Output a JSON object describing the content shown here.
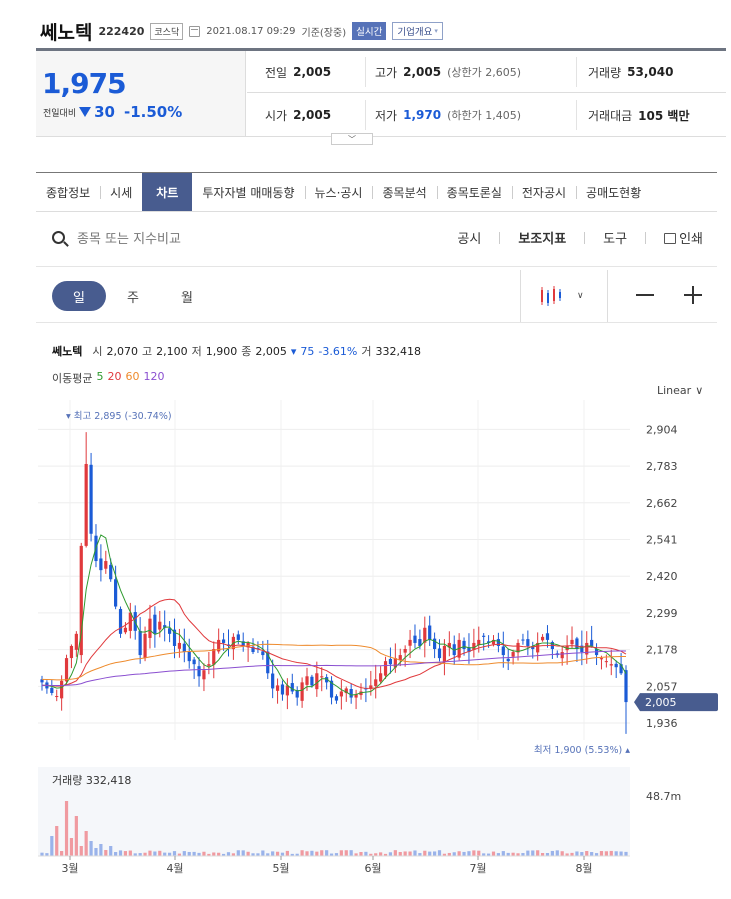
{
  "header": {
    "company": "쎄노텍",
    "code": "222420",
    "market": "코스닥",
    "datetime": "2021.08.17 09:29",
    "basis": "기준(장중)",
    "realtime": "실시간",
    "corp_info": "기업개요"
  },
  "quote": {
    "price": "1,975",
    "change_label": "전일대비",
    "change": "30",
    "change_pct": "-1.50%",
    "prev_close_label": "전일",
    "prev_close": "2,005",
    "high_label": "고가",
    "high": "2,005",
    "upper_limit": "(상한가 2,605)",
    "volume_label": "거래량",
    "volume": "53,040",
    "open_label": "시가",
    "open": "2,005",
    "low_label": "저가",
    "low": "1,970",
    "lower_limit": "(하한가 1,405)",
    "amount_label": "거래대금",
    "amount": "105 백만"
  },
  "tabs": [
    "종합정보",
    "시세",
    "차트",
    "투자자별 매매동향",
    "뉴스·공시",
    "종목분석",
    "종목토론실",
    "전자공시",
    "공매도현황"
  ],
  "active_tab": "차트",
  "search": {
    "placeholder": "종목 또는 지수비교"
  },
  "tools": {
    "disclosure": "공시",
    "indicators": "보조지표",
    "tools": "도구",
    "print": "인쇄"
  },
  "periods": [
    "일",
    "주",
    "월"
  ],
  "active_period": "일",
  "chart_info": {
    "name": "쎄노텍",
    "open_label": "시",
    "open": "2,070",
    "high_label": "고",
    "high": "2,100",
    "low_label": "저",
    "low": "1,900",
    "close_label": "종",
    "close": "2,005",
    "change": "75",
    "change_pct": "-3.61%",
    "vol_label": "거",
    "vol": "332,418"
  },
  "ma_legend": {
    "label": "이동평균",
    "ma5": "5",
    "ma20": "20",
    "ma60": "60",
    "ma120": "120"
  },
  "scale_mode": "Linear",
  "volume_label": "거래량 332,418",
  "colors": {
    "up": "#e0393c",
    "down": "#1b5bd6",
    "accent": "#485c8f"
  },
  "chart_data": {
    "type": "candlestick",
    "y_ticks": [
      "2,904",
      "2,783",
      "2,662",
      "2,541",
      "2,420",
      "2,299",
      "2,178",
      "2,057",
      "1,936"
    ],
    "ylim": [
      1880,
      2935
    ],
    "x_ticks": [
      "3월",
      "4월",
      "5월",
      "6월",
      "7월",
      "8월"
    ],
    "current_price_tag": "2,005",
    "high_marker": "최고 2,895 (-30.74%)",
    "low_marker": "최저 1,900 (5.53%)",
    "volume_axis_tick": "48.7m",
    "close_series": [
      2070,
      2050,
      2035,
      2025,
      2075,
      2150,
      2190,
      2230,
      2520,
      2790,
      2560,
      2470,
      2440,
      2470,
      2410,
      2320,
      2230,
      2250,
      2300,
      2240,
      2160,
      2230,
      2280,
      2230,
      2270,
      2250,
      2230,
      2190,
      2200,
      2170,
      2140,
      2130,
      2090,
      2110,
      2130,
      2180,
      2210,
      2200,
      2190,
      2220,
      2210,
      2190,
      2200,
      2170,
      2180,
      2160,
      2100,
      2050,
      2060,
      2030,
      2060,
      2040,
      2020,
      2070,
      2090,
      2060,
      2100,
      2090,
      2070,
      2020,
      2010,
      2040,
      2050,
      2020,
      2030,
      2040,
      2050,
      2060,
      2080,
      2100,
      2140,
      2130,
      2150,
      2160,
      2180,
      2210,
      2200,
      2190,
      2250,
      2210,
      2180,
      2150,
      2190,
      2200,
      2160,
      2210,
      2180,
      2170,
      2200,
      2210,
      2220,
      2200,
      2210,
      2190,
      2160,
      2140,
      2170,
      2200,
      2210,
      2190,
      2180,
      2200,
      2220,
      2210,
      2180,
      2160,
      2170,
      2190,
      2210,
      2180,
      2170,
      2200,
      2190,
      2160,
      2150,
      2140,
      2130,
      2120,
      2100,
      2005
    ]
  }
}
